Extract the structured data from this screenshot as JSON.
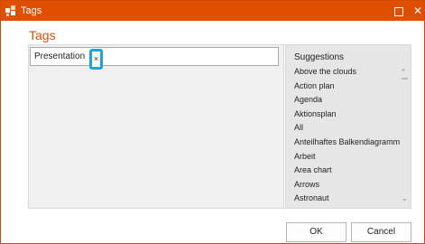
{
  "window": {
    "title": "Tags",
    "close_glyph": "✕",
    "accent_color": "#e04e00",
    "highlight_color": "#1fa4d4"
  },
  "heading": "Tags",
  "tags": [
    {
      "label": "Presentation",
      "remove_glyph": "×"
    }
  ],
  "suggestions": {
    "title": "Suggestions",
    "items": [
      "Above the clouds",
      "Action plan",
      "Agenda",
      "Aktionsplan",
      "All",
      "Anteilhaftes Balkendiagramm",
      "Arbeit",
      "Area chart",
      "Arrows",
      "Astronaut"
    ],
    "scroll_up_glyph": "^",
    "scroll_down_glyph": "⌄"
  },
  "buttons": {
    "ok": "OK",
    "cancel": "Cancel"
  },
  "icons": {
    "app": "tags-app-icon",
    "maximize": "maximize-icon",
    "close": "close-icon"
  }
}
